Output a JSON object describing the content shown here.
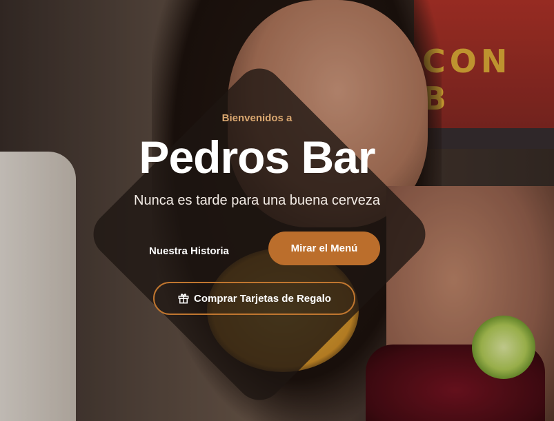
{
  "hero": {
    "eyebrow": "Bienvenidos a",
    "title": "Pedros Bar",
    "subtitle": "Nunca es tarde para una buena cerveza"
  },
  "actions": {
    "history_label": "Nuestra Historia",
    "menu_label": "Mirar el Menú",
    "gift_label": "Comprar Tarjetas de Regalo",
    "gift_icon": "gift-icon"
  },
  "colors": {
    "accent": "#bb6e2c",
    "eyebrow": "#d9a770",
    "overlay": "#1e1612"
  }
}
